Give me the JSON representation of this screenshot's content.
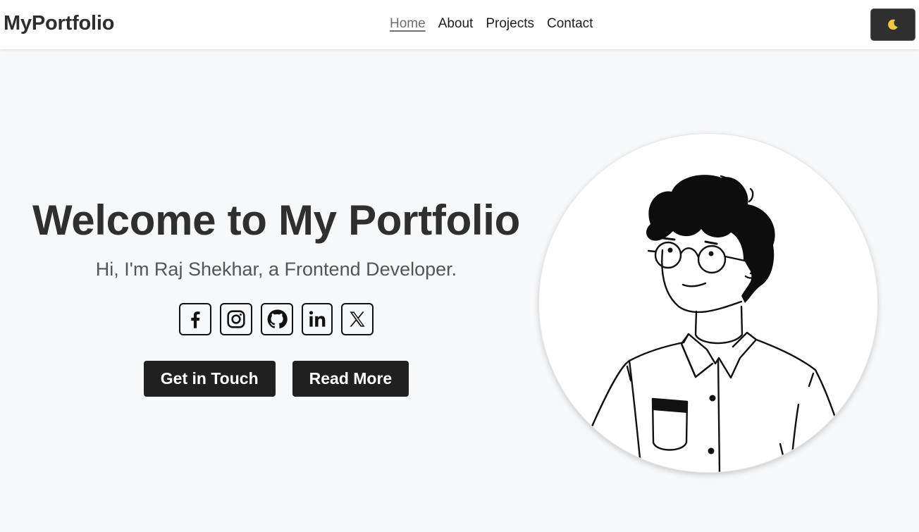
{
  "navbar": {
    "brand": "MyPortfolio",
    "links": [
      {
        "label": "Home",
        "active": true
      },
      {
        "label": "About",
        "active": false
      },
      {
        "label": "Projects",
        "active": false
      },
      {
        "label": "Contact",
        "active": false
      }
    ],
    "theme_toggle_icon": "moon-icon"
  },
  "hero": {
    "title": "Welcome to My Portfolio",
    "subtitle": "Hi, I'm Raj Shekhar, a Frontend Developer.",
    "social_icons": [
      "facebook-icon",
      "instagram-icon",
      "github-icon",
      "linkedin-icon",
      "x-icon"
    ],
    "buttons": {
      "primary": "Get in Touch",
      "secondary": "Read More"
    }
  },
  "colors": {
    "background": "#f7f8fa",
    "navbar_bg": "#ffffff",
    "button_bg": "#1f201f",
    "moon": "#f5c542"
  }
}
